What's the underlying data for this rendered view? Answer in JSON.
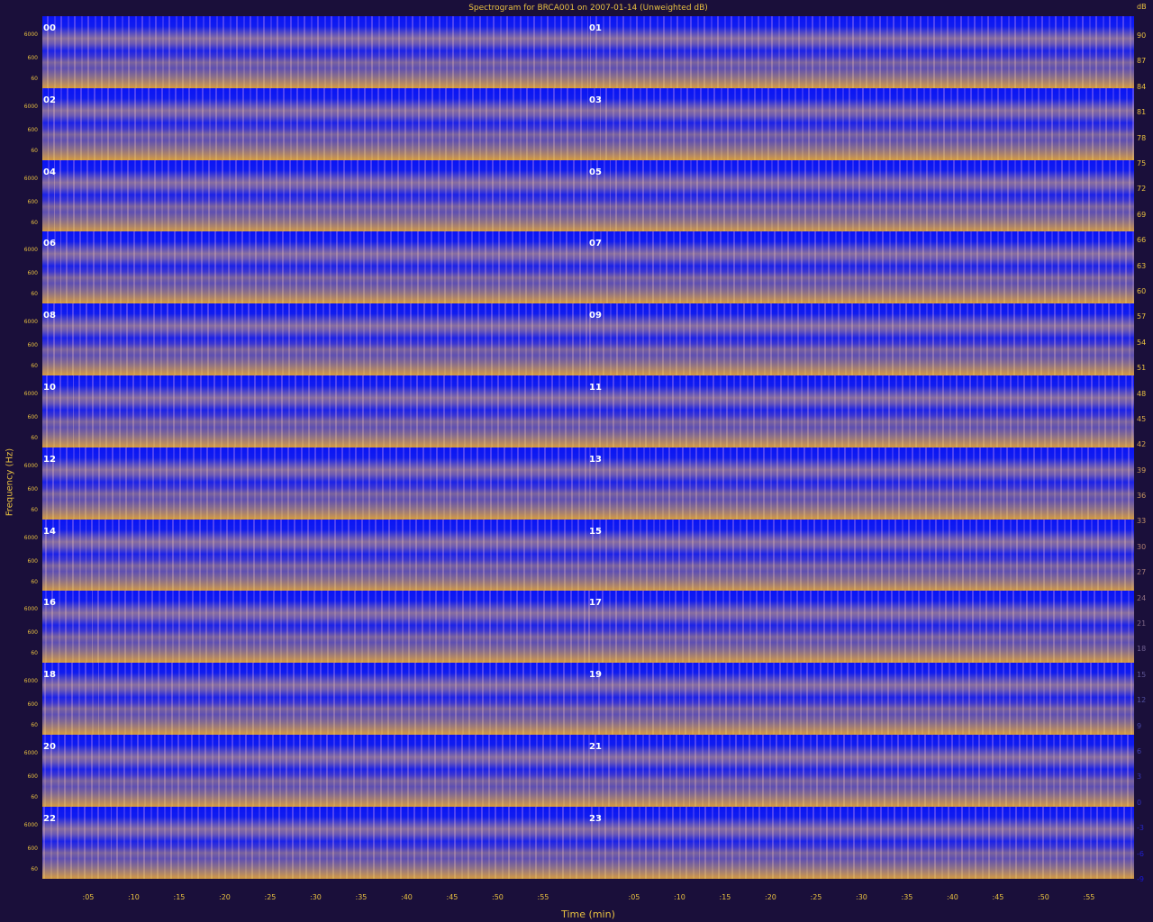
{
  "title": "Spectrogram for BRCA001 on 2007-01-14 (Unweighted dB)",
  "chart_data": {
    "type": "heatmap",
    "title": "Spectrogram for BRCA001 on 2007-01-14 (Unweighted dB)",
    "xlabel": "Time (min)",
    "ylabel": "Frequency (Hz)",
    "hours": [
      "00",
      "01",
      "02",
      "03",
      "04",
      "05",
      "06",
      "07",
      "08",
      "09",
      "10",
      "11",
      "12",
      "13",
      "14",
      "15",
      "16",
      "17",
      "18",
      "19",
      "20",
      "21",
      "22",
      "23"
    ],
    "freq_ticks": [
      "6000",
      "600",
      "60"
    ],
    "time_ticks": [
      ":05",
      ":10",
      ":15",
      ":20",
      ":25",
      ":30",
      ":35",
      ":40",
      ":45",
      ":50",
      ":55",
      ":05",
      ":10",
      ":15",
      ":20",
      ":25",
      ":30",
      ":35",
      ":40",
      ":45",
      ":50",
      ":55"
    ],
    "colorbar_unit": "dB",
    "colorbar_ticks": [
      {
        "value": 90,
        "color": "#e8c040"
      },
      {
        "value": 87,
        "color": "#e8c040"
      },
      {
        "value": 84,
        "color": "#e8c040"
      },
      {
        "value": 81,
        "color": "#e8c040"
      },
      {
        "value": 78,
        "color": "#e8c040"
      },
      {
        "value": 75,
        "color": "#e8c040"
      },
      {
        "value": 72,
        "color": "#e8c040"
      },
      {
        "value": 69,
        "color": "#e8c040"
      },
      {
        "value": 66,
        "color": "#e8c040"
      },
      {
        "value": 63,
        "color": "#e8c040"
      },
      {
        "value": 60,
        "color": "#e8c040"
      },
      {
        "value": 57,
        "color": "#e8c040"
      },
      {
        "value": 54,
        "color": "#e8c040"
      },
      {
        "value": 51,
        "color": "#e8c040"
      },
      {
        "value": 48,
        "color": "#e8c040"
      },
      {
        "value": 45,
        "color": "#e0b048"
      },
      {
        "value": 42,
        "color": "#d8a850"
      },
      {
        "value": 39,
        "color": "#d0a058"
      },
      {
        "value": 36,
        "color": "#c89860"
      },
      {
        "value": 33,
        "color": "#c09068"
      },
      {
        "value": 30,
        "color": "#b08070"
      },
      {
        "value": 27,
        "color": "#a07878"
      },
      {
        "value": 24,
        "color": "#907080"
      },
      {
        "value": 21,
        "color": "#806888"
      },
      {
        "value": 18,
        "color": "#706090"
      },
      {
        "value": 15,
        "color": "#605898"
      },
      {
        "value": 12,
        "color": "#5050a0"
      },
      {
        "value": 9,
        "color": "#4848a8"
      },
      {
        "value": 6,
        "color": "#4040b0"
      },
      {
        "value": 3,
        "color": "#3838b8"
      },
      {
        "value": 0,
        "color": "#3030c0"
      },
      {
        "value": -3,
        "color": "#2828c8"
      },
      {
        "value": -6,
        "color": "#2020d0"
      },
      {
        "value": -9,
        "color": "#1818d8"
      }
    ],
    "colormap": {
      "low": "#0a14f5",
      "mid": "#8a6fa0",
      "high": "#e8a030"
    },
    "grid": false
  }
}
